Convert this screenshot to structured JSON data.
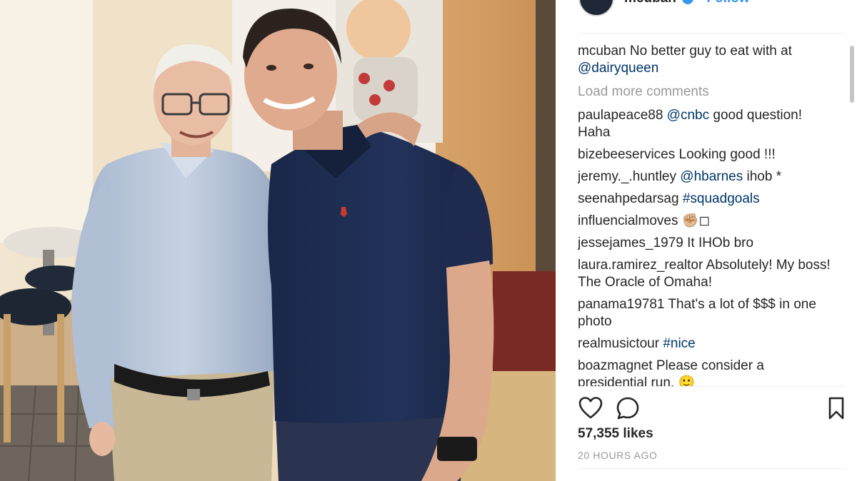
{
  "post": {
    "photo_description_icon": "post-photo",
    "username": "mcuban",
    "follow_label": "Follow",
    "separator": "•",
    "caption": {
      "user": "mcuban",
      "text": " No better guy to eat with at ",
      "mention": "@dairyqueen"
    },
    "load_more_label": "Load more comments",
    "comments": [
      {
        "user": "paulapeace88",
        "parts": [
          {
            "t": " ",
            "m": false
          },
          {
            "t": "@cnbc",
            "m": true
          },
          {
            "t": " good question! Haha",
            "m": false
          }
        ]
      },
      {
        "user": "bizebeeservices",
        "parts": [
          {
            "t": " Looking good !!!",
            "m": false
          }
        ]
      },
      {
        "user": "jeremy._.huntley",
        "parts": [
          {
            "t": " ",
            "m": false
          },
          {
            "t": "@hbarnes",
            "m": true
          },
          {
            "t": " ihob *",
            "m": false
          }
        ]
      },
      {
        "user": "seenahpedarsag",
        "parts": [
          {
            "t": " ",
            "m": false
          },
          {
            "t": "#squadgoals",
            "m": true
          }
        ]
      },
      {
        "user": "influencialmoves",
        "parts": [
          {
            "t": " ✊🏼◻",
            "m": false
          }
        ]
      },
      {
        "user": "jessejames_1979",
        "parts": [
          {
            "t": " It IHOb bro",
            "m": false
          }
        ]
      },
      {
        "user": "laura.ramirez_realtor",
        "parts": [
          {
            "t": " Absolutely! My boss! The Oracle of Omaha!",
            "m": false
          }
        ]
      },
      {
        "user": "panama19781",
        "parts": [
          {
            "t": " That's a lot of $$$ in one photo",
            "m": false
          }
        ]
      },
      {
        "user": "realmusictour",
        "parts": [
          {
            "t": " ",
            "m": false
          },
          {
            "t": "#nice",
            "m": true
          }
        ]
      },
      {
        "user": "boazmagnet",
        "parts": [
          {
            "t": " Please consider a presidential run. 🙂",
            "m": false
          }
        ]
      }
    ],
    "likes_text": "57,355 likes",
    "time_text": "20 HOURS AGO",
    "icons": {
      "like": "heart-icon",
      "comment": "comment-icon",
      "save": "bookmark-icon",
      "verified": "verified-badge-icon"
    },
    "colors": {
      "mention": "#003569",
      "follow": "#3897f0",
      "muted": "#999999",
      "text": "#262626"
    }
  }
}
